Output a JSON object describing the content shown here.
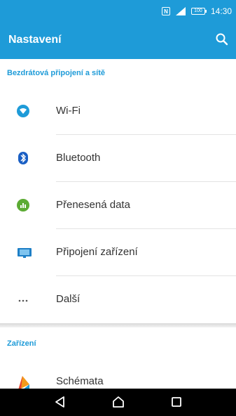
{
  "status_bar": {
    "time": "14:30",
    "battery": "100"
  },
  "app_bar": {
    "title": "Nastavení"
  },
  "sections": [
    {
      "header": "Bezdrátová připojení a sítě"
    },
    {
      "header": "Zařízení"
    }
  ],
  "items": [
    {
      "label": "Wi-Fi",
      "icon": "wifi-icon"
    },
    {
      "label": "Bluetooth",
      "icon": "bluetooth-icon"
    },
    {
      "label": "Přenesená data",
      "icon": "data-usage-icon"
    },
    {
      "label": "Připojení zařízení",
      "icon": "device-connection-icon"
    },
    {
      "label": "Další",
      "icon": "more-icon"
    },
    {
      "label": "Schémata",
      "icon": "themes-icon"
    }
  ],
  "colors": {
    "accent": "#1e9bd8",
    "nav_bar": "#000000"
  }
}
